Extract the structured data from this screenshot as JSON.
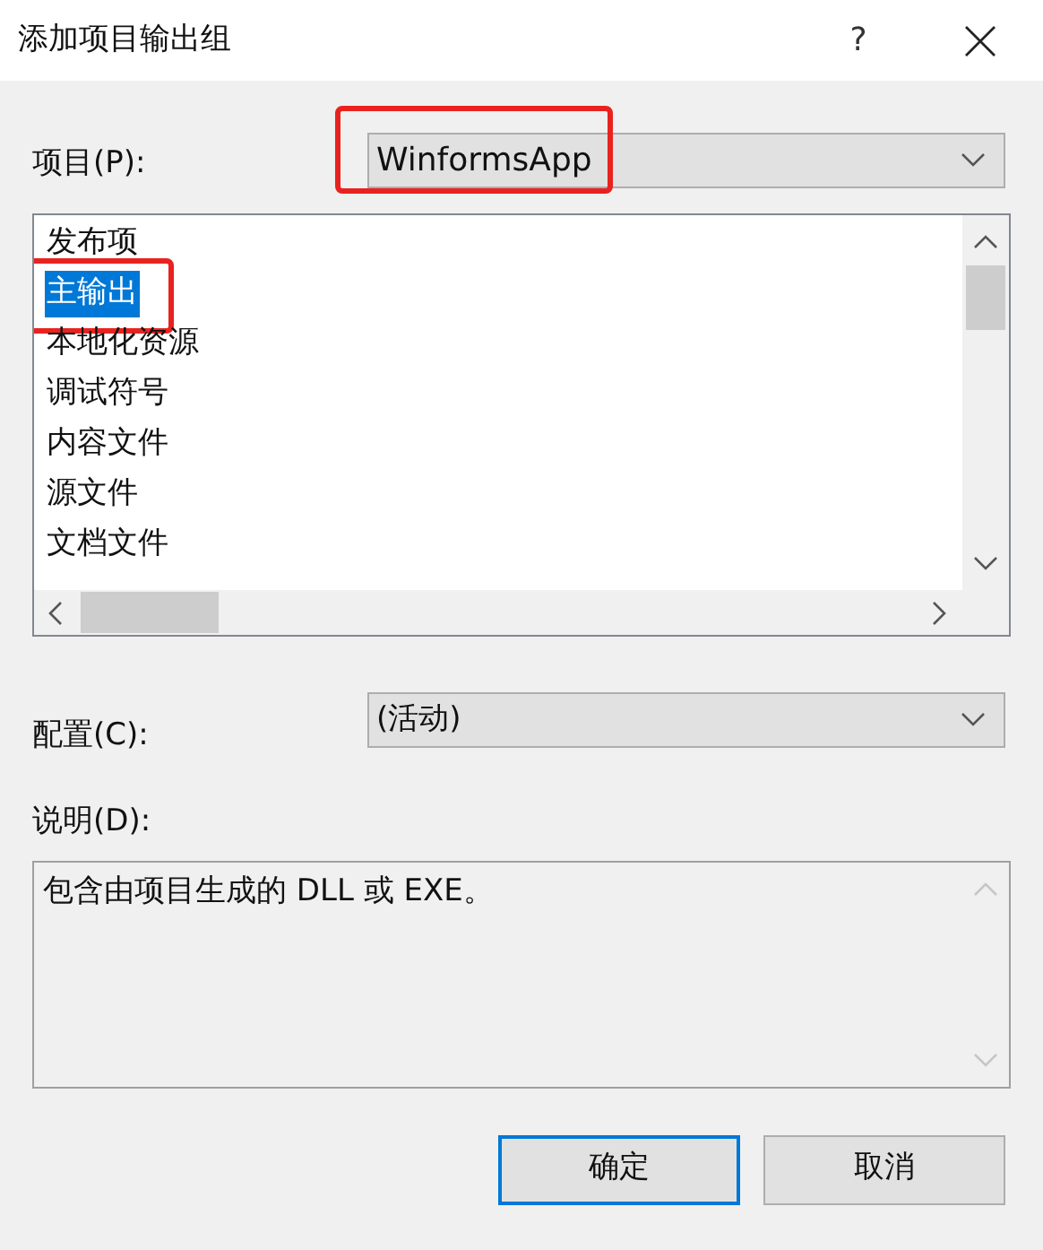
{
  "window": {
    "title": "添加项目输出组",
    "help": "?"
  },
  "project": {
    "label": "项目(P):",
    "value": "WinformsApp",
    "highlighted": true
  },
  "outputs": [
    {
      "label": "发布项",
      "selected": false,
      "highlighted": false
    },
    {
      "label": "主输出",
      "selected": true,
      "highlighted": true
    },
    {
      "label": "本地化资源",
      "selected": false,
      "highlighted": false
    },
    {
      "label": "调试符号",
      "selected": false,
      "highlighted": false
    },
    {
      "label": "内容文件",
      "selected": false,
      "highlighted": false
    },
    {
      "label": "源文件",
      "selected": false,
      "highlighted": false
    },
    {
      "label": "文档文件",
      "selected": false,
      "highlighted": false
    }
  ],
  "configuration": {
    "label": "配置(C):",
    "value": "(活动)"
  },
  "description": {
    "label": "说明(D):",
    "text": "包含由项目生成的 DLL 或 EXE。"
  },
  "buttons": [
    {
      "label": "确定",
      "default": true
    },
    {
      "label": "取消",
      "default": false
    }
  ]
}
